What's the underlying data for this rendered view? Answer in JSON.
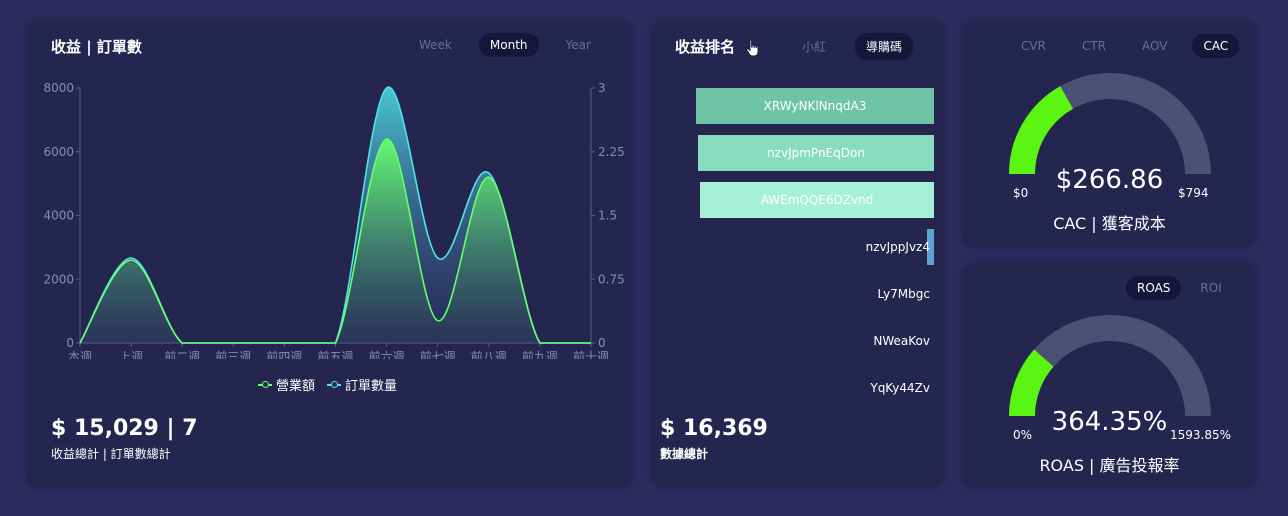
{
  "revenue_card": {
    "title": "收益 | 訂單數",
    "tabs": [
      {
        "label": "Week",
        "active": false
      },
      {
        "label": "Month",
        "active": true
      },
      {
        "label": "Year",
        "active": false
      }
    ],
    "legend": [
      {
        "label": "營業額",
        "color": "#66ff6e"
      },
      {
        "label": "訂單數量",
        "color": "#4fe3ea"
      }
    ],
    "total_value": "$ 15,029 | 7",
    "total_label": "收益總計 | 訂單數總計"
  },
  "chart_data": {
    "type": "area",
    "categories": [
      "本週",
      "上週",
      "前二週",
      "前三週",
      "前四週",
      "前五週",
      "前六週",
      "前七週",
      "前八週",
      "前九週",
      "前十週"
    ],
    "y_left": {
      "ticks": [
        "0",
        "2000",
        "4000",
        "6000",
        "8000"
      ],
      "ylim": [
        0,
        8000
      ]
    },
    "y_right": {
      "ticks": [
        "0",
        "0.75",
        "1.5",
        "2.25",
        "3"
      ],
      "ylim": [
        0,
        3
      ]
    },
    "series": [
      {
        "name": "營業額",
        "axis": "left",
        "color": "#66ff6e",
        "values": [
          0,
          2600,
          0,
          0,
          0,
          0,
          6400,
          700,
          5200,
          0,
          0
        ]
      },
      {
        "name": "訂單數量",
        "axis": "right",
        "color": "#4fe3ea",
        "values": [
          0,
          1,
          0,
          0,
          0,
          0,
          3,
          1,
          2,
          0,
          0
        ]
      }
    ],
    "grid": false
  },
  "ranking_card": {
    "title": "收益排名",
    "tabs": [
      {
        "label": "小紅",
        "active": false
      },
      {
        "label": "導購碼",
        "active": true
      }
    ],
    "items": [
      {
        "name": "XRWyNKlNnqdA3",
        "value": 5450,
        "color": "#6ec4a4"
      },
      {
        "name": "nzvJpmPnEqDon",
        "value": 5400,
        "color": "#87dcbe"
      },
      {
        "name": "AWEmQQE6DZvnd",
        "value": 5350,
        "color": "#a6f1d6"
      },
      {
        "name": "nzvJppJvz4",
        "value": 169,
        "color": "#5fa3d2"
      },
      {
        "name": "Ly7Mbgc",
        "value": 0,
        "color": "#5fa3d2"
      },
      {
        "name": "NWeaKov",
        "value": 0,
        "color": "#5fa3d2"
      },
      {
        "name": "YqKy44Zv",
        "value": 0,
        "color": "#5fa3d2"
      }
    ],
    "total_value": "$ 16,369",
    "total_label": "數據總計"
  },
  "cac_card": {
    "tabs": [
      {
        "label": "CVR",
        "active": false
      },
      {
        "label": "CTR",
        "active": false
      },
      {
        "label": "AOV",
        "active": false
      },
      {
        "label": "CAC",
        "active": true
      }
    ],
    "value": "$266.86",
    "min": "$0",
    "max": "$794",
    "fraction": 0.336,
    "caption": "CAC | 獲客成本",
    "fill_color": "#5bf513",
    "track_color": "#4a5172"
  },
  "roas_card": {
    "tabs": [
      {
        "label": "ROAS",
        "active": true
      },
      {
        "label": "ROI",
        "active": false
      }
    ],
    "value": "364.35%",
    "min": "0%",
    "max": "1593.85%",
    "fraction": 0.229,
    "caption": "ROAS | 廣告投報率",
    "fill_color": "#5bf513",
    "track_color": "#4a5172"
  }
}
